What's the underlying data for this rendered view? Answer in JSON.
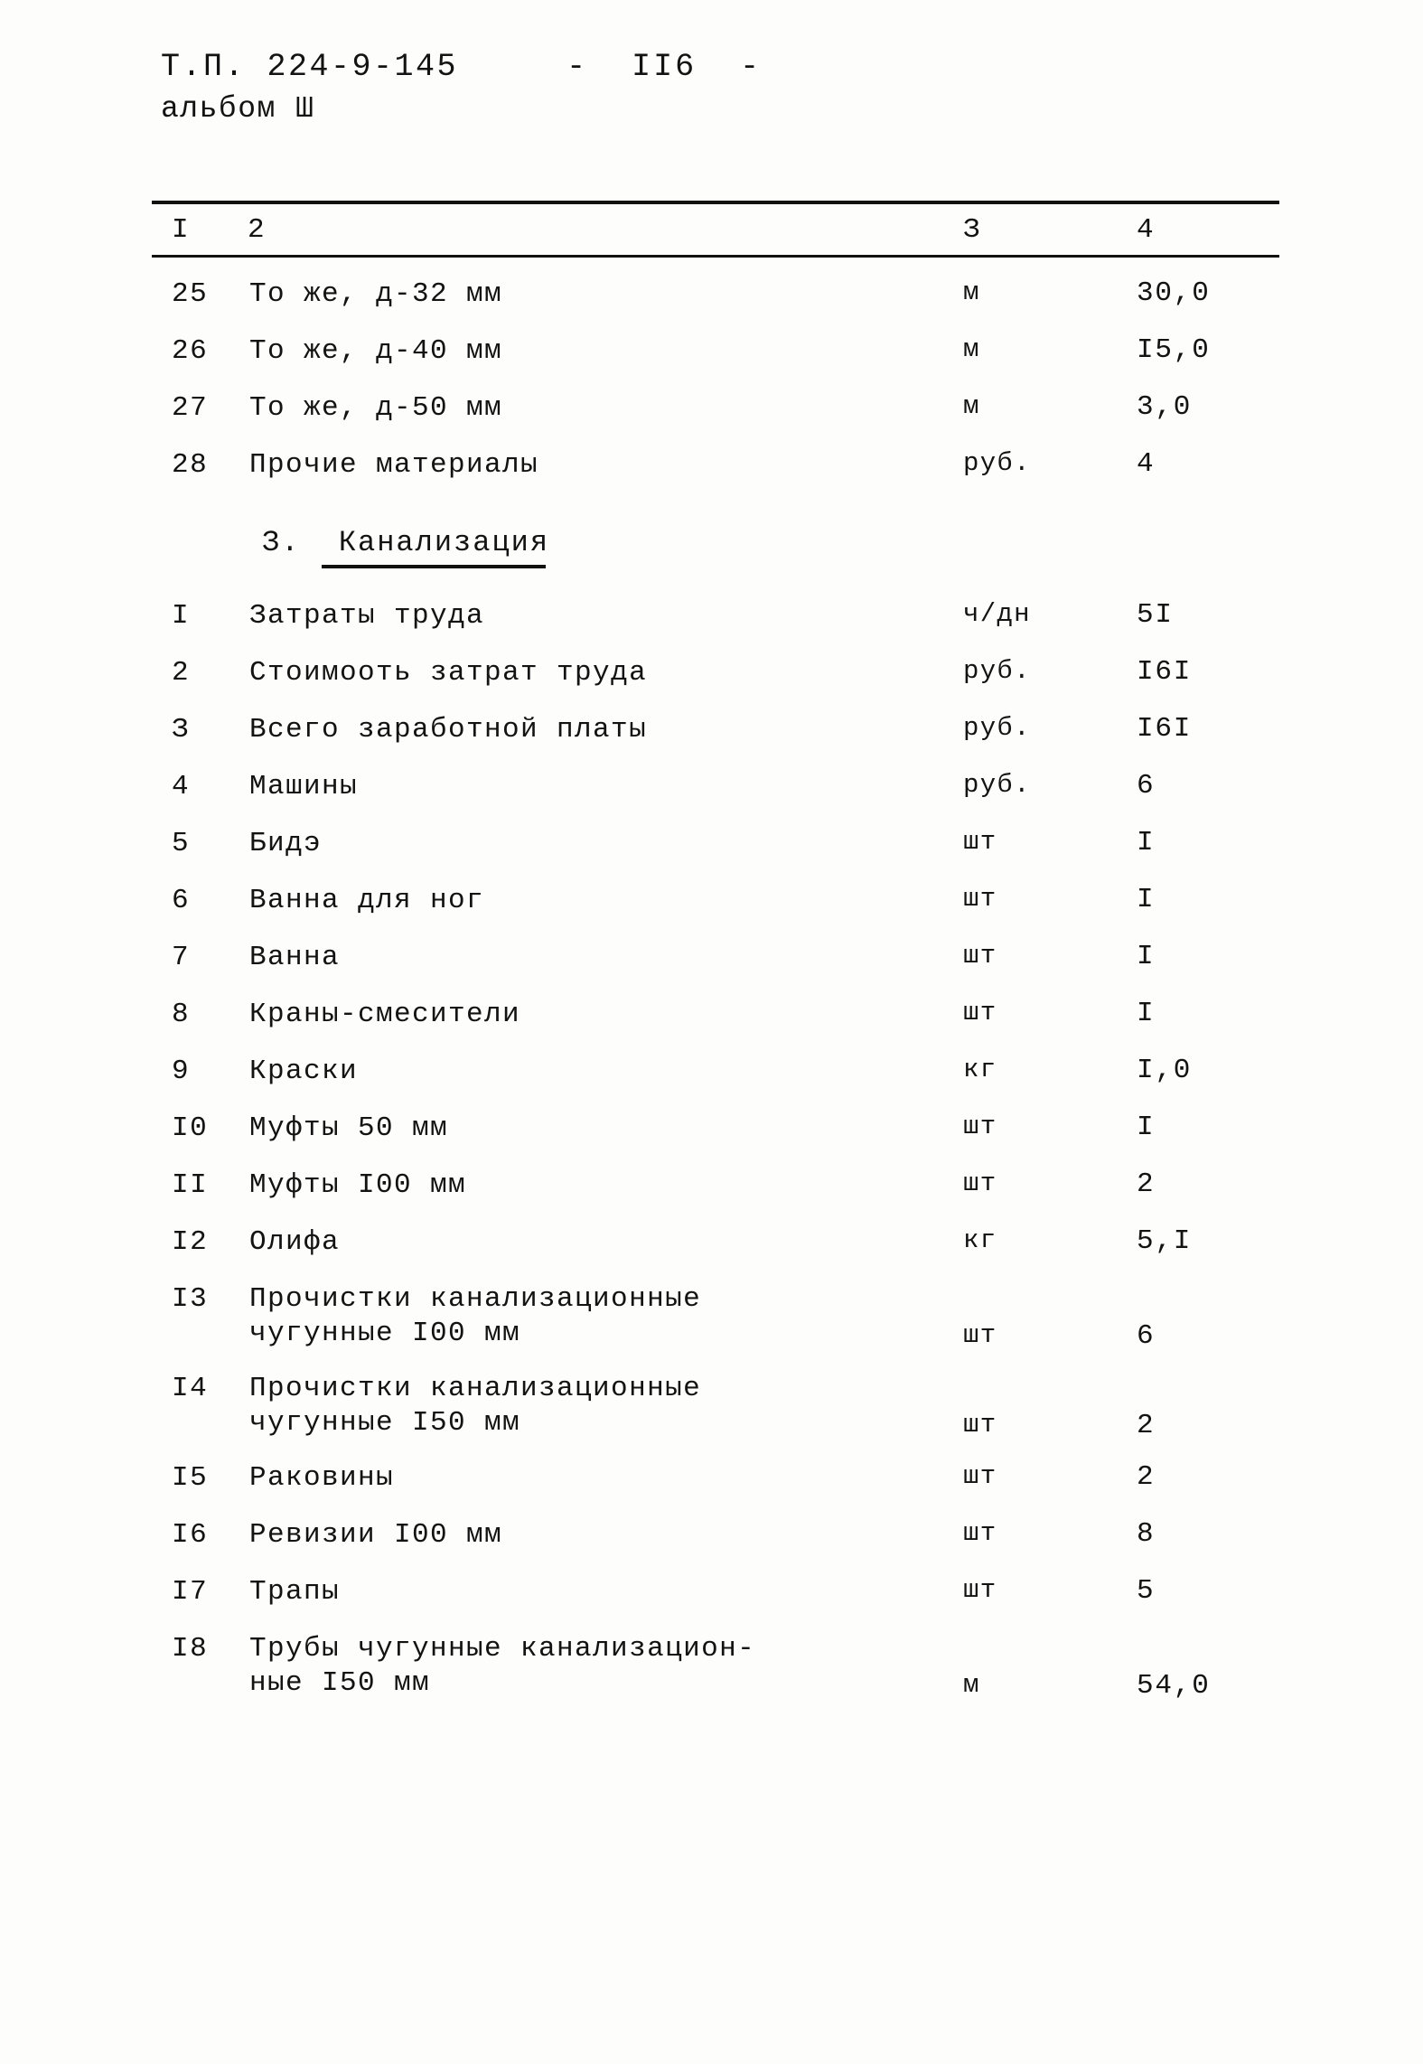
{
  "header": {
    "doc_code": "Т.П. 224-9-145",
    "page_number": "-  II6  -",
    "album": "альбом Ш"
  },
  "table": {
    "column_headers": {
      "num": "I",
      "name": "2",
      "unit": "З",
      "value": "4"
    },
    "rows_before_section": [
      {
        "num": "25",
        "name": "То же, д-32 мм",
        "unit": "м",
        "value": "30,0"
      },
      {
        "num": "26",
        "name": "То же, д-40 мм",
        "unit": "м",
        "value": "I5,0"
      },
      {
        "num": "27",
        "name": "То же, д-50 мм",
        "unit": "м",
        "value": "3,0"
      },
      {
        "num": "28",
        "name": "Прочие материалы",
        "unit": "руб.",
        "value": "4"
      }
    ],
    "section": {
      "number": "З.",
      "title": "Канализация"
    },
    "rows_after_section": [
      {
        "num": "I",
        "name": "Затраты труда",
        "unit": "ч/дн",
        "value": "5I"
      },
      {
        "num": "2",
        "name": "Стоимооть затрат труда",
        "unit": "руб.",
        "value": "I6I"
      },
      {
        "num": "З",
        "name": "Всего заработной платы",
        "unit": "руб.",
        "value": "I6I"
      },
      {
        "num": "4",
        "name": "Машины",
        "unit": "руб.",
        "value": "6"
      },
      {
        "num": "5",
        "name": "Бидэ",
        "unit": "шт",
        "value": "I"
      },
      {
        "num": "6",
        "name": "Ванна для ног",
        "unit": "шт",
        "value": "I"
      },
      {
        "num": "7",
        "name": "Ванна",
        "unit": "шт",
        "value": "I"
      },
      {
        "num": "8",
        "name": "Краны-смесители",
        "unit": "шт",
        "value": "I"
      },
      {
        "num": "9",
        "name": "Краски",
        "unit": "кг",
        "value": "I,0"
      },
      {
        "num": "I0",
        "name": "Муфты 50 мм",
        "unit": "шт",
        "value": "I"
      },
      {
        "num": "II",
        "name": "Муфты I00 мм",
        "unit": "шт",
        "value": "2"
      },
      {
        "num": "I2",
        "name": "Олифа",
        "unit": "кг",
        "value": "5,I"
      },
      {
        "num": "I3",
        "name": "Прочистки канализационные\nчугунные I00 мм",
        "unit": "шт",
        "value": "6",
        "two_line": true
      },
      {
        "num": "I4",
        "name": "Прочистки канализационные\nчугунные I50 мм",
        "unit": "шт",
        "value": "2",
        "two_line": true
      },
      {
        "num": "I5",
        "name": "Раковины",
        "unit": "шт",
        "value": "2"
      },
      {
        "num": "I6",
        "name": "Ревизии I00 мм",
        "unit": "шт",
        "value": "8"
      },
      {
        "num": "I7",
        "name": "Трапы",
        "unit": "шт",
        "value": "5"
      },
      {
        "num": "I8",
        "name": "Трубы чугунные канализацион-\nные I50 мм",
        "unit": "м",
        "value": "54,0",
        "two_line": true
      }
    ]
  }
}
